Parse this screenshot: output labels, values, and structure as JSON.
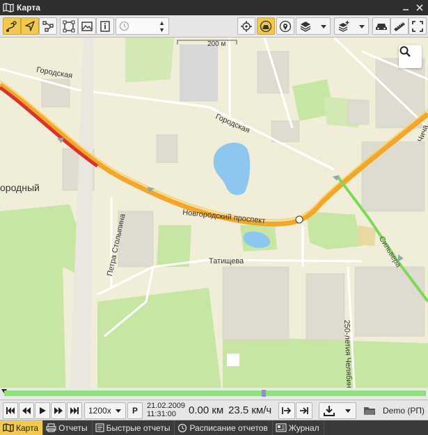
{
  "window": {
    "title": "Карта",
    "buttons": [
      "minimize",
      "close"
    ]
  },
  "toolbar": {
    "left_tools": [
      "track-tool",
      "navigate-tool",
      "route-tool",
      "area-select-tool",
      "image-tool",
      "info-tool"
    ],
    "active_tools": [
      "track-tool",
      "navigate-tool"
    ],
    "right_tools": [
      "center-target",
      "follow-vehicle",
      "place-marker",
      "layers",
      "add-layer",
      "vehicle",
      "ruler",
      "fullscreen"
    ],
    "time_value": ""
  },
  "map": {
    "scale_label": "200 м",
    "labels": {
      "gorodskaya_1": "Городская",
      "gorodskaya_2": "Городская",
      "district": "ородный",
      "stolypina": "Петра Столыпина",
      "prospect": "Новгородский проспект",
      "tatishcheva": "Татищева",
      "chelyabinsk": "250-летия Челябинска",
      "chich": "Чича",
      "silvera": "Сильвера"
    },
    "colors": {
      "land": "#f0edd9",
      "park": "#c8e6a3",
      "water": "#8dc6ee",
      "road_orange": "#f4a62a",
      "road_red": "#d9342b",
      "track_green": "#7ed957"
    }
  },
  "timeline": {
    "progress_marker": 0.615
  },
  "playbar": {
    "speed_select": "1200x",
    "p_label": "P",
    "date": "21.02.2009",
    "time": "11:31:00",
    "distance": "0.00 км",
    "speed": "23.5 км/ч",
    "account": "Demo (РП)"
  },
  "tabs": [
    {
      "label": "Карта",
      "icon": "map-icon",
      "active": true
    },
    {
      "label": "Отчеты",
      "icon": "printer-icon",
      "active": false
    },
    {
      "label": "Быстрые отчеты",
      "icon": "report-icon",
      "active": false
    },
    {
      "label": "Расписание отчетов",
      "icon": "clock-icon",
      "active": false
    },
    {
      "label": "Журнал",
      "icon": "journal-icon",
      "active": false
    }
  ]
}
